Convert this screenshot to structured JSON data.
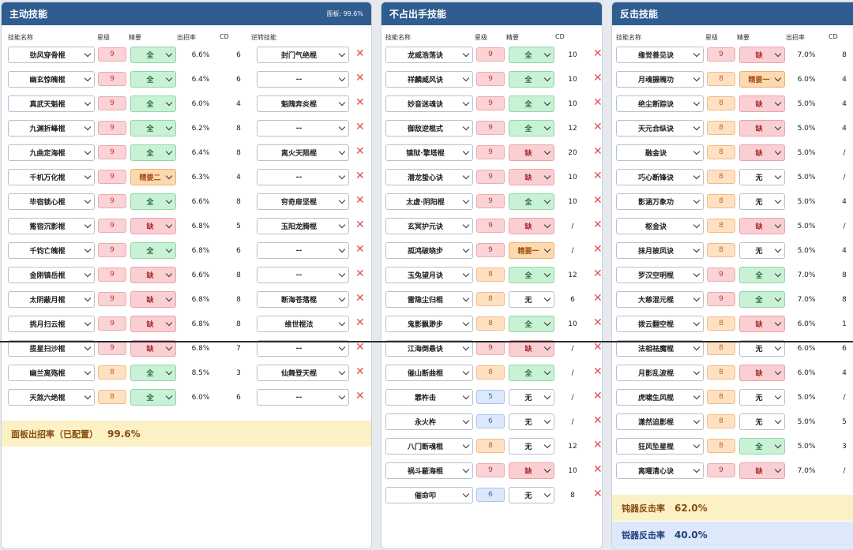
{
  "active_panel": {
    "title": "主动技能",
    "header_right": "面板: 99.6%",
    "columns": [
      "技能名称",
      "星级",
      "精要",
      "出招率",
      "CD",
      "逆转技能"
    ],
    "rows": [
      {
        "name": "劲风穿骨棍",
        "star": "9",
        "essence": "全",
        "rate": "6.6%",
        "cd": "6",
        "reverse": "封门气绝棍"
      },
      {
        "name": "幽玄惊魄棍",
        "star": "9",
        "essence": "全",
        "rate": "6.4%",
        "cd": "6",
        "reverse": "--"
      },
      {
        "name": "真武天魁棍",
        "star": "9",
        "essence": "全",
        "rate": "6.0%",
        "cd": "4",
        "reverse": "魁隗奔炎棍"
      },
      {
        "name": "九渊折峰棍",
        "star": "9",
        "essence": "全",
        "rate": "6.2%",
        "cd": "8",
        "reverse": "--"
      },
      {
        "name": "九曲定海棍",
        "star": "9",
        "essence": "全",
        "rate": "6.4%",
        "cd": "8",
        "reverse": "离火天陨棍"
      },
      {
        "name": "千机万化棍",
        "star": "9",
        "essence": "精要二",
        "rate": "6.3%",
        "cd": "4",
        "reverse": "--"
      },
      {
        "name": "毕宿锁心棍",
        "star": "9",
        "essence": "全",
        "rate": "6.6%",
        "cd": "8",
        "reverse": "穷奇扉坚棍"
      },
      {
        "name": "觜宿沉影棍",
        "star": "9",
        "essence": "缺",
        "rate": "6.8%",
        "cd": "5",
        "reverse": "玉阳龙腾棍"
      },
      {
        "name": "千钧亡魄棍",
        "star": "9",
        "essence": "全",
        "rate": "6.8%",
        "cd": "6",
        "reverse": "--"
      },
      {
        "name": "金刚镇岳棍",
        "star": "9",
        "essence": "缺",
        "rate": "6.6%",
        "cd": "8",
        "reverse": "--"
      },
      {
        "name": "太阴蔽月棍",
        "star": "9",
        "essence": "缺",
        "rate": "6.8%",
        "cd": "8",
        "reverse": "断海苍落棍"
      },
      {
        "name": "挑月扫云棍",
        "star": "9",
        "essence": "缺",
        "rate": "6.8%",
        "cd": "8",
        "reverse": "维世棍法"
      },
      {
        "name": "揽星扫沙棍",
        "star": "9",
        "essence": "缺",
        "rate": "6.8%",
        "cd": "7",
        "reverse": "--"
      },
      {
        "name": "幽兰离殇棍",
        "star": "8",
        "essence": "全",
        "rate": "8.5%",
        "cd": "3",
        "reverse": "仙舞登天棍"
      },
      {
        "name": "天煞六绝棍",
        "star": "8",
        "essence": "全",
        "rate": "6.0%",
        "cd": "6",
        "reverse": "--"
      }
    ],
    "summary_label": "面板出招率（已配置）",
    "summary_value": "99.6%"
  },
  "passive_panel": {
    "title": "不占出手技能",
    "columns": [
      "技能名称",
      "星级",
      "精要",
      "CD"
    ],
    "rows": [
      {
        "name": "龙威浩荡诀",
        "star": "9",
        "essence": "全",
        "cd": "10"
      },
      {
        "name": "祥麟威风诀",
        "star": "9",
        "essence": "全",
        "cd": "10"
      },
      {
        "name": "妙音迷魂诀",
        "star": "9",
        "essence": "全",
        "cd": "10"
      },
      {
        "name": "御敌逆棍式",
        "star": "9",
        "essence": "全",
        "cd": "12"
      },
      {
        "name": "镇狱·擎塔棍",
        "star": "9",
        "essence": "缺",
        "cd": "20"
      },
      {
        "name": "潜龙蛰心诀",
        "star": "9",
        "essence": "缺",
        "cd": "10"
      },
      {
        "name": "太虚·阴阳棍",
        "star": "9",
        "essence": "全",
        "cd": "10"
      },
      {
        "name": "玄冥护元诀",
        "star": "9",
        "essence": "缺",
        "cd": "/"
      },
      {
        "name": "孤鸿破晓步",
        "star": "9",
        "essence": "精要一",
        "cd": "/"
      },
      {
        "name": "玉兔望月诀",
        "star": "8",
        "essence": "全",
        "cd": "12"
      },
      {
        "name": "雷隐尘归棍",
        "star": "8",
        "essence": "无",
        "cd": "6"
      },
      {
        "name": "鬼影飘渺步",
        "star": "8",
        "essence": "全",
        "cd": "10"
      },
      {
        "name": "江海倒悬诀",
        "star": "9",
        "essence": "缺",
        "cd": "/"
      },
      {
        "name": "催山断曲棍",
        "star": "8",
        "essence": "全",
        "cd": "/"
      },
      {
        "name": "霏杵击",
        "star": "5",
        "essence": "无",
        "cd": "/"
      },
      {
        "name": "永火杵",
        "star": "6",
        "essence": "无",
        "cd": "/"
      },
      {
        "name": "八门断魂棍",
        "star": "8",
        "essence": "无",
        "cd": "12"
      },
      {
        "name": "祸斗蔽海棍",
        "star": "9",
        "essence": "缺",
        "cd": "10"
      },
      {
        "name": "催命叩",
        "star": "6",
        "essence": "无",
        "cd": "8"
      }
    ]
  },
  "counter_panel": {
    "title": "反击技能",
    "columns": [
      "技能名称",
      "星级",
      "精要",
      "出招率",
      "CD"
    ],
    "rows": [
      {
        "name": "缘觉善见诀",
        "star": "9",
        "essence": "缺",
        "rate": "7.0%",
        "cd": "8"
      },
      {
        "name": "月魂摄魄功",
        "star": "8",
        "essence": "精要一",
        "rate": "6.0%",
        "cd": "4"
      },
      {
        "name": "绝尘断踪诀",
        "star": "8",
        "essence": "缺",
        "rate": "5.0%",
        "cd": "4"
      },
      {
        "name": "天元合纵诀",
        "star": "8",
        "essence": "缺",
        "rate": "5.0%",
        "cd": "4"
      },
      {
        "name": "融金诀",
        "star": "8",
        "essence": "缺",
        "rate": "5.0%",
        "cd": "/"
      },
      {
        "name": "巧心断锋诀",
        "star": "8",
        "essence": "无",
        "rate": "5.0%",
        "cd": "/"
      },
      {
        "name": "影涵万象功",
        "star": "8",
        "essence": "无",
        "rate": "5.0%",
        "cd": "4"
      },
      {
        "name": "枢金诀",
        "star": "8",
        "essence": "缺",
        "rate": "5.0%",
        "cd": "/"
      },
      {
        "name": "抹月披风诀",
        "star": "8",
        "essence": "无",
        "rate": "5.0%",
        "cd": "4"
      },
      {
        "name": "罗汉空明棍",
        "star": "9",
        "essence": "全",
        "rate": "7.0%",
        "cd": "8"
      },
      {
        "name": "大慈混元棍",
        "star": "9",
        "essence": "全",
        "rate": "7.0%",
        "cd": "8"
      },
      {
        "name": "拨云翻空棍",
        "star": "8",
        "essence": "缺",
        "rate": "6.0%",
        "cd": "1"
      },
      {
        "name": "法相祛魔棍",
        "star": "8",
        "essence": "无",
        "rate": "6.0%",
        "cd": "6"
      },
      {
        "name": "月影乱波棍",
        "star": "8",
        "essence": "缺",
        "rate": "6.0%",
        "cd": "4"
      },
      {
        "name": "虎啸生风棍",
        "star": "8",
        "essence": "无",
        "rate": "5.0%",
        "cd": "/"
      },
      {
        "name": "潇然追影棍",
        "star": "8",
        "essence": "无",
        "rate": "5.0%",
        "cd": "5"
      },
      {
        "name": "狂风坠星棍",
        "star": "8",
        "essence": "全",
        "rate": "5.0%",
        "cd": "3"
      },
      {
        "name": "离曜清心诀",
        "star": "9",
        "essence": "缺",
        "rate": "7.0%",
        "cd": "/"
      }
    ],
    "blunt_label": "钝器反击率",
    "blunt_value": "62.0%",
    "sharp_label": "锐器反击率",
    "sharp_value": "40.0%"
  },
  "colors": {
    "header_bg": "#2f5d8f",
    "full": "#c9f1d5",
    "missing": "#f9cfd3",
    "partial": "#fcd9b0",
    "star9": "#f9d3d6",
    "star8": "#fde1c2",
    "star_low": "#dde8fb"
  },
  "icons": {
    "remove": "close-icon",
    "dropdown": "chevron-down-icon"
  }
}
